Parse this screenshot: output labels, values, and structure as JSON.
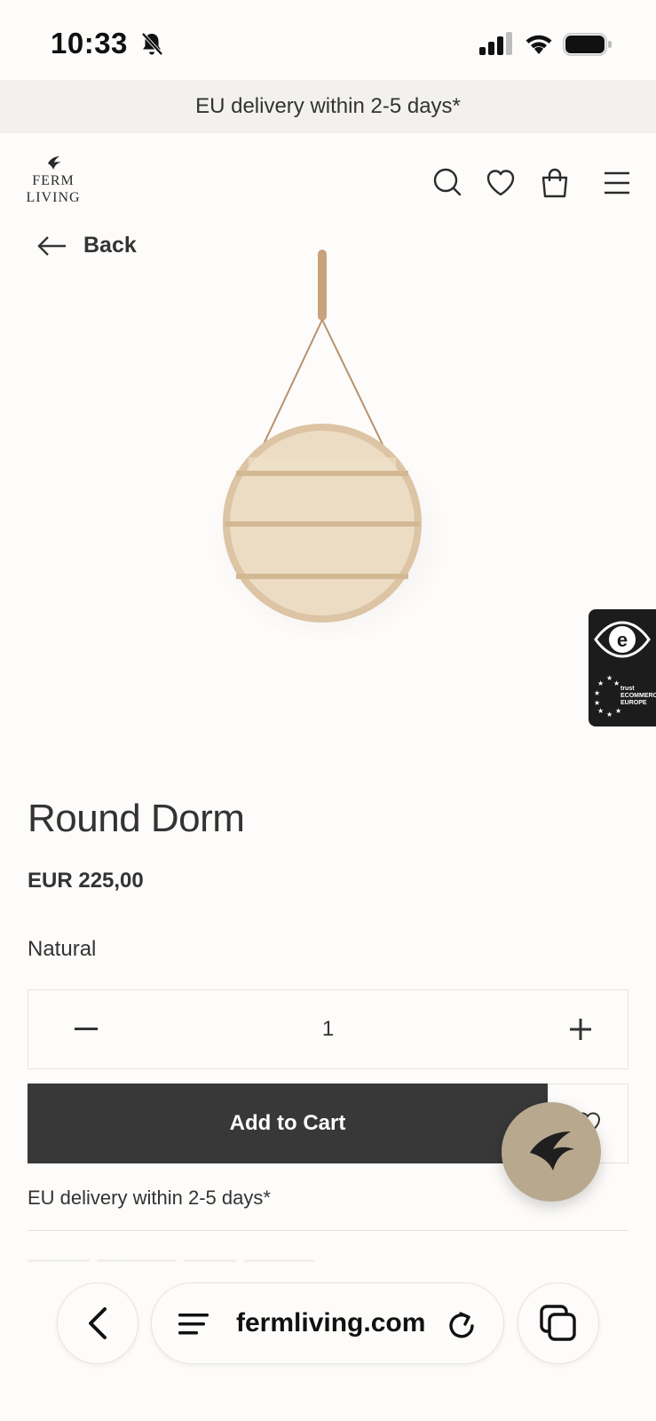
{
  "status_bar": {
    "time": "10:33"
  },
  "promo_bar": {
    "text": "EU delivery within 2-5 days*"
  },
  "header": {
    "logo_line1": "FERM",
    "logo_line2": "LIVING",
    "icons": [
      "search-icon",
      "heart-icon",
      "shopping-bag-icon",
      "menu-icon"
    ]
  },
  "back_link": {
    "label": "Back"
  },
  "product": {
    "title": "Round Dorm",
    "price": "EUR 225,00",
    "variant": "Natural",
    "quantity": "1",
    "add_to_cart_label": "Add to Cart",
    "delivery_note": "EU delivery within 2-5 days*"
  },
  "trust_badge": {
    "line1": "trust",
    "line2": "ECOMMERCE",
    "line3": "EUROPE"
  },
  "browser": {
    "url": "fermliving.com"
  },
  "colors": {
    "background": "#fdfcfa",
    "promo_bg": "#f2f1ee",
    "cart_button": "#383838",
    "chat_fab": "#b8a88e",
    "wood": "#e8d4b6"
  }
}
